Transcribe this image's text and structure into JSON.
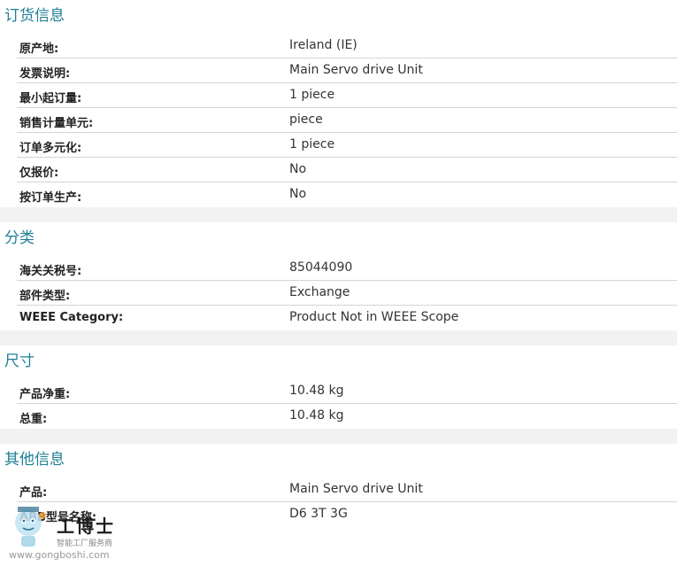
{
  "sections": [
    {
      "title": "订货信息",
      "rows": [
        {
          "label": "原产地:",
          "value": "Ireland (IE)"
        },
        {
          "label": "发票说明:",
          "value": "Main Servo drive Unit"
        },
        {
          "label": "最小起订量:",
          "value": "1 piece"
        },
        {
          "label": "销售计量单元:",
          "value": "piece"
        },
        {
          "label": "订单多元化:",
          "value": "1 piece"
        },
        {
          "label": "仅报价:",
          "value": "No"
        },
        {
          "label": "按订单生产:",
          "value": "No"
        }
      ]
    },
    {
      "title": "分类",
      "rows": [
        {
          "label": "海关关税号:",
          "value": "85044090"
        },
        {
          "label": "部件类型:",
          "value": "Exchange"
        },
        {
          "label": "WEEE Category:",
          "value": "Product Not in WEEE Scope"
        }
      ]
    },
    {
      "title": "尺寸",
      "rows": [
        {
          "label": "产品净重:",
          "value": "10.48 kg"
        },
        {
          "label": "总重:",
          "value": "10.48 kg"
        }
      ]
    },
    {
      "title": "其他信息",
      "rows": [
        {
          "label": "产品:",
          "value": "Main Servo drive Unit"
        },
        {
          "label": "ABB型号名称:",
          "value": "D6 3T 3G"
        }
      ]
    }
  ],
  "watermark": {
    "brand": "工博士",
    "subtitle": "智能工厂服务商",
    "url": "www.gongboshi.com"
  }
}
